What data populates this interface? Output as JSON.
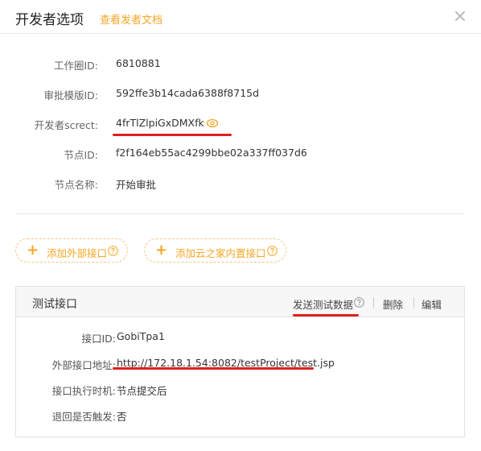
{
  "header": {
    "title": "开发者选项",
    "doc_link": "查看发者文档",
    "close_icon": "close-icon"
  },
  "info": [
    {
      "label": "工作圈ID:",
      "value": "6810881"
    },
    {
      "label": "审批模版ID:",
      "value": "592ffe3b14cada6388f8715d"
    },
    {
      "label": "开发者screct:",
      "value": "4frTlZlpiGxDMXfk"
    },
    {
      "label": "节点ID:",
      "value": "f2f164eb55ac4299bbe02a337ff037d6"
    },
    {
      "label": "节点名称:",
      "value": "开始审批"
    }
  ],
  "buttons": {
    "add_external": "添加外部接口",
    "add_builtin": "添加云之家内置接口"
  },
  "test_panel": {
    "title": "测试接口",
    "actions": {
      "send": "发送测试数据",
      "delete": "删除",
      "edit": "编辑"
    },
    "rows": [
      {
        "label": "接口ID:",
        "value": "GobiTpa1"
      },
      {
        "label": "外部接口地址:",
        "value": "http://172.18.1.54:8082/testProject/test.jsp"
      },
      {
        "label": "接口执行时机:",
        "value": "节点提交后"
      },
      {
        "label": "退回是否触发:",
        "value": "否"
      }
    ]
  },
  "colors": {
    "accent": "#f5a623",
    "highlight": "#e02020"
  },
  "icons": [
    "close-icon",
    "eye-icon",
    "plus-icon",
    "question-icon"
  ]
}
